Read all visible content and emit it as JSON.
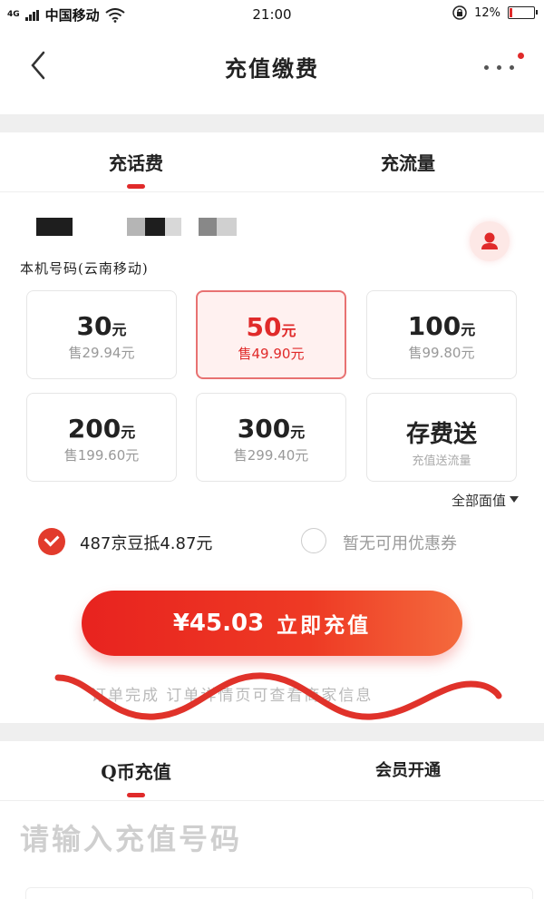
{
  "status_bar": {
    "signal_label": "4G",
    "carrier": "中国移动",
    "time": "21:00",
    "battery": "12%",
    "battery_level": 0.12,
    "battery_color": "#e02a2a"
  },
  "nav": {
    "title": "充值缴费",
    "back_icon": "chevron-left-icon",
    "more_icon": "more-dots-icon"
  },
  "top_tabs": [
    {
      "label": "充话费",
      "active": true
    },
    {
      "label": "充流量",
      "active": false
    }
  ],
  "phone": {
    "number_masked": true,
    "caption": "本机号码(云南移动)",
    "contact_icon": "contact-person-icon"
  },
  "packages": [
    {
      "amount": "30",
      "unit": "元",
      "price": "售29.94元",
      "selected": false
    },
    {
      "amount": "50",
      "unit": "元",
      "price": "售49.90元",
      "selected": true
    },
    {
      "amount": "100",
      "unit": "元",
      "price": "售99.80元",
      "selected": false
    },
    {
      "amount": "200",
      "unit": "元",
      "price": "售199.60元",
      "selected": false
    },
    {
      "amount": "300",
      "unit": "元",
      "price": "售299.40元",
      "selected": false
    }
  ],
  "promo_card": {
    "title": "存费送",
    "subtitle": "充值送流量"
  },
  "all_values_label": "全部面值",
  "options": {
    "beans": {
      "label": "487京豆抵4.87元",
      "checked": true
    },
    "coupon": {
      "label": "暂无可用优惠券",
      "checked": false
    }
  },
  "pay_button": {
    "price": "¥45.03",
    "label": "立即充值"
  },
  "notice": "订单完成  订单详情页可查看商家信息",
  "bottom_tabs": [
    {
      "label": "Q币充值",
      "active": true
    },
    {
      "label": "会员开通",
      "active": false
    }
  ],
  "recharge_input": {
    "placeholder": "请输入充值号码"
  },
  "colors": {
    "accent": "#e02a2a",
    "selected_bg": "#fff1f0"
  }
}
